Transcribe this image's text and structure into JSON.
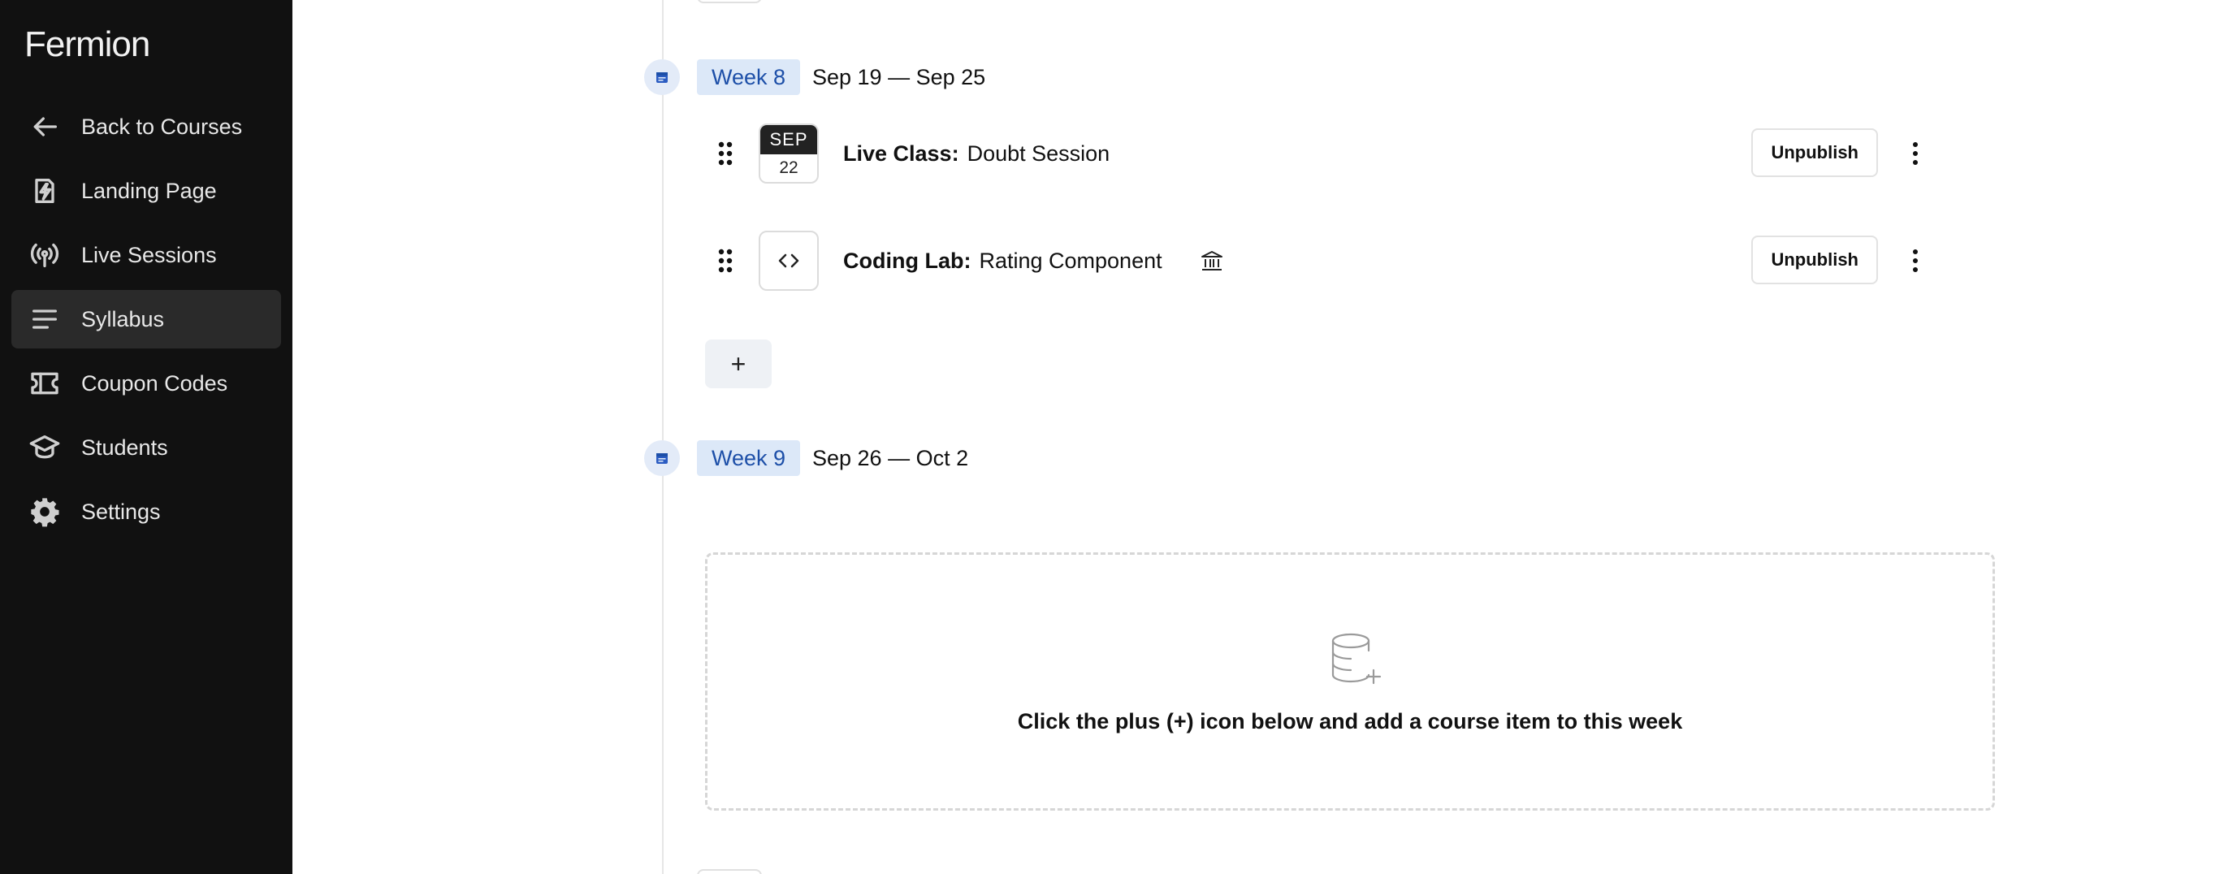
{
  "app": {
    "logo": "Fermion"
  },
  "sidebar": {
    "items": [
      {
        "label": "Back to Courses",
        "icon": "arrow-left-icon"
      },
      {
        "label": "Landing Page",
        "icon": "lightning-page-icon"
      },
      {
        "label": "Live Sessions",
        "icon": "broadcast-icon"
      },
      {
        "label": "Syllabus",
        "icon": "list-lines-icon",
        "active": true
      },
      {
        "label": "Coupon Codes",
        "icon": "ticket-icon"
      },
      {
        "label": "Students",
        "icon": "graduation-cap-icon"
      },
      {
        "label": "Settings",
        "icon": "gear-icon"
      }
    ]
  },
  "weeks": [
    {
      "label": "Week 8",
      "range": "Sep 19 — Sep 25",
      "items": [
        {
          "type": "Live Class:",
          "title": "Doubt Session",
          "month": "SEP",
          "day": "22",
          "action": "Unpublish"
        },
        {
          "type": "Coding Lab:",
          "title": "Rating Component",
          "icon": "code-brackets-icon",
          "badge_icon": "bank-icon",
          "action": "Unpublish"
        }
      ],
      "add_label": "+"
    },
    {
      "label": "Week 9",
      "range": "Sep 26 — Oct 2",
      "empty_message": "Click the plus (+) icon below and add a course item to this week",
      "empty_icon": "database-plus-icon"
    }
  ],
  "colors": {
    "sidebar_bg": "#111111",
    "week_badge_bg": "#dce8f8",
    "week_badge_text": "#1d4fa8",
    "active_nav_bg": "#2a2a2a"
  }
}
